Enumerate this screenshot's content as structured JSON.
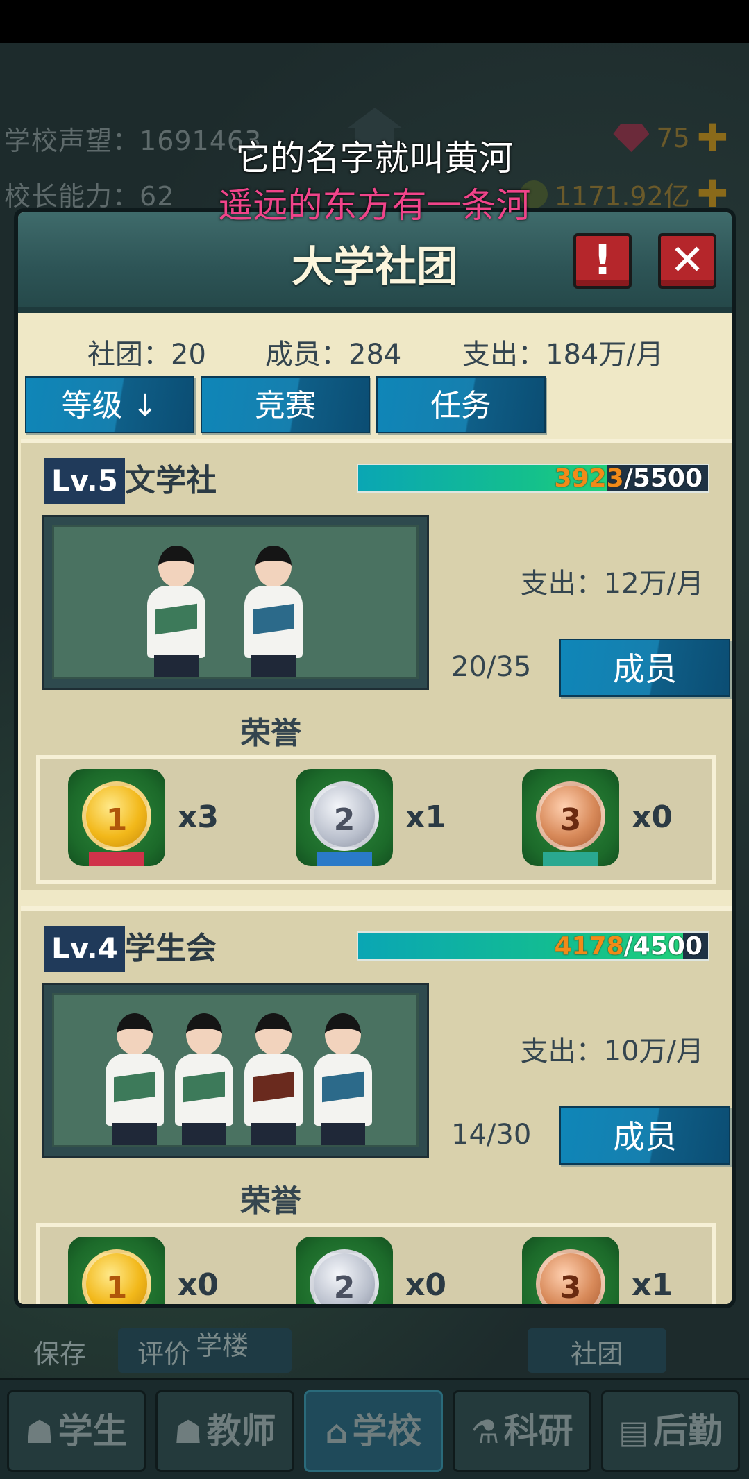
{
  "hud": {
    "reputation_label": "学校声望：",
    "reputation_value": "1691463",
    "ability_label": "校长能力：",
    "ability_value": "62",
    "gems": "75",
    "money": "1171.92亿"
  },
  "subtitles": {
    "line1": "它的名字就叫黄河",
    "line2": "遥远的东方有一条河"
  },
  "panel": {
    "title": "大学社团",
    "alert_label": "!",
    "close_label": "✕",
    "stats": {
      "clubs": "社团：20",
      "members": "成员：284",
      "spend": "支出：184万/月"
    },
    "tabs": [
      "等级 ↓",
      "竞赛",
      "任务"
    ]
  },
  "clubs": [
    {
      "level": "Lv.5",
      "name": "文学社",
      "progress_current": "3923",
      "progress_max": "/5500",
      "progress_fraction": 0.713,
      "spend": "支出：12万/月",
      "members": "20/35",
      "members_button": "成员",
      "honor_label": "荣誉",
      "medals": [
        {
          "rank": "1",
          "count": "x3"
        },
        {
          "rank": "2",
          "count": "x1"
        },
        {
          "rank": "3",
          "count": "x0"
        }
      ]
    },
    {
      "level": "Lv.4",
      "name": "学生会",
      "progress_current": "4178",
      "progress_max": "/4500",
      "progress_fraction": 0.928,
      "spend": "支出：10万/月",
      "members": "14/30",
      "members_button": "成员",
      "honor_label": "荣誉",
      "medals": [
        {
          "rank": "1",
          "count": "x0"
        },
        {
          "rank": "2",
          "count": "x0"
        },
        {
          "rank": "3",
          "count": "x1"
        }
      ]
    }
  ],
  "map_labels": {
    "save": "保存",
    "rate": "评价",
    "building": "学楼",
    "club": "社团"
  },
  "nav": [
    "学生",
    "教师",
    "学校",
    "科研",
    "后勤"
  ],
  "colors": {
    "accent_blue": "#0f86b8",
    "panel_bg": "#efe8c6",
    "progress_current": "#f28a18",
    "close_red": "#b5262b"
  }
}
